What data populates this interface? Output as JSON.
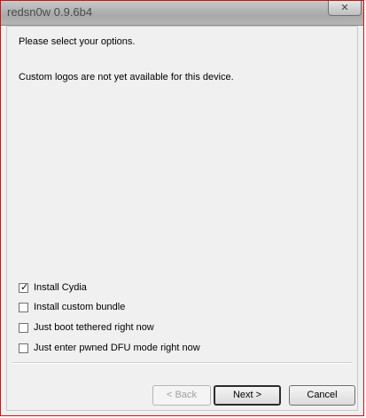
{
  "window": {
    "title": "redsn0w 0.9.6b4",
    "close_glyph": "✕"
  },
  "content": {
    "prompt": "Please select your options.",
    "notice": "Custom logos are not yet available for this device."
  },
  "options": [
    {
      "label": "Install Cydia",
      "checked": true
    },
    {
      "label": "Install custom bundle",
      "checked": false
    },
    {
      "label": "Just boot tethered right now",
      "checked": false
    },
    {
      "label": "Just enter pwned DFU mode right now",
      "checked": false
    }
  ],
  "buttons": {
    "back": "< Back",
    "next": "Next >",
    "cancel": "Cancel"
  },
  "colors": {
    "window_border": "#d01010",
    "panel": "#f0f0f0"
  }
}
